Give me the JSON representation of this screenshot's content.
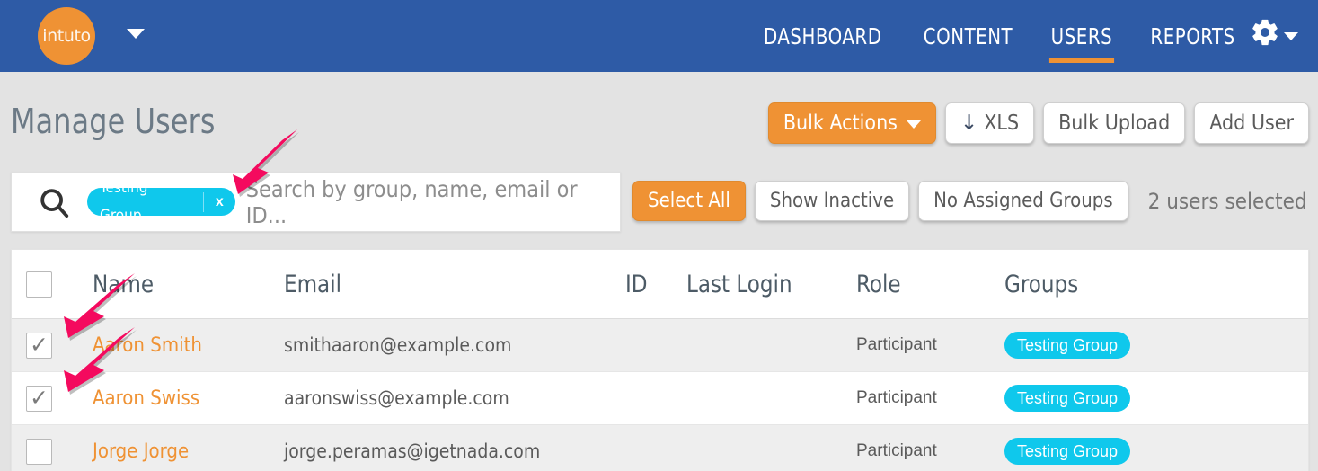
{
  "topnav": {
    "logo_text": "intuto",
    "logo_caret_icon": "chevron-down-icon",
    "items": [
      {
        "label": "DASHBOARD",
        "active": false
      },
      {
        "label": "CONTENT",
        "active": false
      },
      {
        "label": "USERS",
        "active": true
      },
      {
        "label": "REPORTS",
        "active": false
      }
    ],
    "settings_icon": "gear-icon",
    "settings_caret_icon": "chevron-down-icon",
    "background_color": "#2e5ba6",
    "accent_color": "#ef9234"
  },
  "page": {
    "title": "Manage Users",
    "actions": {
      "bulk_actions": "Bulk Actions",
      "xls": "XLS",
      "xls_icon": "download-arrow-icon",
      "bulk_upload": "Bulk Upload",
      "add_user": "Add User"
    }
  },
  "search": {
    "icon": "search-icon",
    "chips": [
      {
        "label": "Testing Group",
        "remove_icon": "x"
      }
    ],
    "placeholder": "Search by group, name, email or ID..."
  },
  "filters": {
    "select_all": "Select All",
    "show_inactive": "Show Inactive",
    "no_assigned_groups": "No Assigned Groups",
    "selected_count_text": "2 users selected"
  },
  "table": {
    "columns": [
      "Name",
      "Email",
      "ID",
      "Last Login",
      "Role",
      "Groups"
    ],
    "header_checkbox_checked": false,
    "rows": [
      {
        "checked": true,
        "name": "Aaron Smith",
        "email": "smithaaron@example.com",
        "id": "",
        "last_login": "",
        "role": "Participant",
        "groups": [
          "Testing Group"
        ]
      },
      {
        "checked": true,
        "name": "Aaron Swiss",
        "email": "aaronswiss@example.com",
        "id": "",
        "last_login": "",
        "role": "Participant",
        "groups": [
          "Testing Group"
        ]
      },
      {
        "checked": false,
        "name": "Jorge Jorge",
        "email": "jorge.peramas@igetnada.com",
        "id": "",
        "last_login": "",
        "role": "Participant",
        "groups": [
          "Testing Group"
        ]
      }
    ]
  },
  "annotations": {
    "arrow_color": "#f40a5e",
    "arrows": [
      {
        "name": "arrow-to-chip-remove"
      },
      {
        "name": "arrow-to-row1-checkbox"
      },
      {
        "name": "arrow-to-row2-checkbox"
      }
    ]
  },
  "colors": {
    "page_background": "#e3e3e3",
    "chip_cyan": "#0fc8ec",
    "link_orange": "#ef9234"
  }
}
